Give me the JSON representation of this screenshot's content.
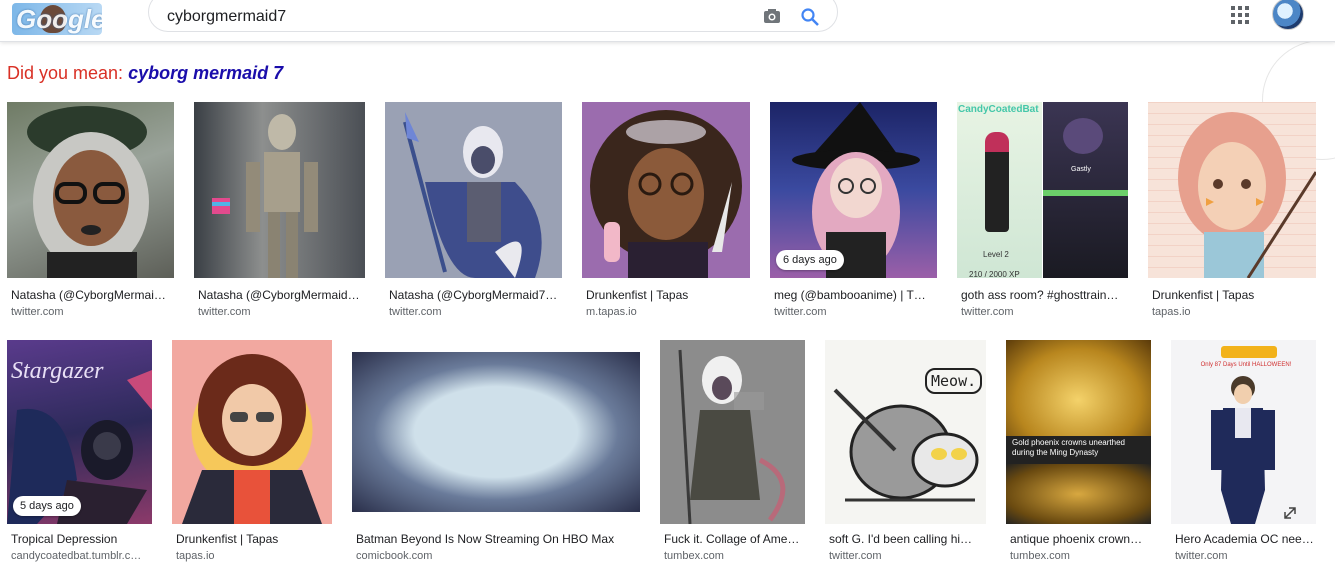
{
  "header": {
    "logo_text": "Google",
    "search_value": "cyborgmermaid7",
    "camera_icon": "camera-icon",
    "search_icon": "search-icon",
    "apps_icon": "apps-grid-icon"
  },
  "spelling": {
    "prefix": "Did you mean:",
    "suggestion": "cyborg mermaid 7"
  },
  "row1": [
    {
      "caption": "Natasha (@CyborgMermai…",
      "source": "twitter.com",
      "badge": ""
    },
    {
      "caption": "Natasha (@CyborgMermaid…",
      "source": "twitter.com",
      "badge": ""
    },
    {
      "caption": "Natasha (@CyborgMermaid7…",
      "source": "twitter.com",
      "badge": ""
    },
    {
      "caption": "Drunkenfist | Tapas",
      "source": "m.tapas.io",
      "badge": ""
    },
    {
      "caption": "meg (@bambooanime) | T…",
      "source": "twitter.com",
      "badge": "6 days ago"
    },
    {
      "caption": "goth ass room? #ghosttrain…",
      "source": "twitter.com",
      "badge": ""
    },
    {
      "caption": "Drunkenfist | Tapas",
      "source": "tapas.io",
      "badge": ""
    }
  ],
  "row2": [
    {
      "caption": "Tropical Depression",
      "source": "candycoatedbat.tumblr.c…",
      "badge": "5 days ago"
    },
    {
      "caption": "Drunkenfist | Tapas",
      "source": "tapas.io",
      "badge": ""
    },
    {
      "caption": "Batman Beyond Is Now Streaming On HBO Max",
      "source": "comicbook.com",
      "badge": ""
    },
    {
      "caption": "Fuck it. Collage of Ame…",
      "source": "tumbex.com",
      "badge": ""
    },
    {
      "caption": "soft G. I'd been calling hi…",
      "source": "twitter.com",
      "badge": ""
    },
    {
      "caption": "antique phoenix crown…",
      "source": "tumbex.com",
      "badge": ""
    },
    {
      "caption": "Hero Academia OC nee…",
      "source": "twitter.com",
      "badge": ""
    }
  ],
  "image_text": {
    "candy_title": "CandyCoatedBat",
    "gastly": "Gastly",
    "level": "Level 2",
    "xp": "210 / 2000 XP",
    "stargazer": "Stargazer",
    "meow": "Meow.",
    "crown_caption": "Gold phoenix crowns unearthed during the Ming Dynasty",
    "halloween": "Only 87 Days Until HALLOWEEN!"
  },
  "colors": {
    "link": "#1a0dab",
    "did_you_mean": "#d93025",
    "source": "#5f6368"
  }
}
